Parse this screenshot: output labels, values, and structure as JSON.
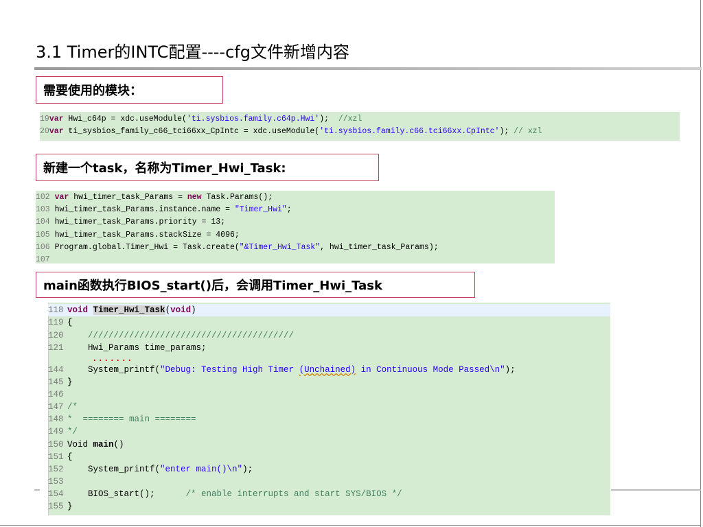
{
  "slide": {
    "title": "3.1 Timer的INTC配置----cfg文件新增内容"
  },
  "sections": {
    "s1_label": "需要使用的模块：",
    "s2_label": "新建一个task，名称为Timer_Hwi_Task:",
    "s3_label": "main函数执行BIOS_start()后，会调用Timer_Hwi_Task"
  },
  "code1": {
    "lines": [
      {
        "n": "19",
        "kw": "var",
        "pre": " Hwi_c64p = xdc.useModule(",
        "str": "'ti.sysbios.family.c64p.Hwi'",
        "post": ");  ",
        "cmt": "//xzl"
      },
      {
        "n": "20",
        "kw": "var",
        "pre": " ti_sysbios_family_c66_tci66xx_CpIntc = xdc.useModule(",
        "str": "'ti.sysbios.family.c66.tci66xx.CpIntc'",
        "post": "); ",
        "cmt": "// xzl"
      }
    ]
  },
  "code2": {
    "lines": [
      {
        "n": "102",
        "a": "var",
        "b": " hwi_timer_task_Params = ",
        "c": "new",
        "d": " Task.Params();"
      },
      {
        "n": "103",
        "a": "",
        "b": "hwi_timer_task_Params.instance.name = ",
        "s": "\"Timer_Hwi\"",
        "d": ";"
      },
      {
        "n": "104",
        "a": "",
        "b": "hwi_timer_task_Params.priority = 13;"
      },
      {
        "n": "105",
        "a": "",
        "b": "hwi_timer_task_Params.stackSize = 4096;"
      },
      {
        "n": "106",
        "a": "",
        "b": "Program.global.Timer_Hwi = Task.create(",
        "s": "\"&Timer_Hwi_Task\"",
        "d": ", hwi_timer_task_Params);"
      },
      {
        "n": "107",
        "a": "",
        "b": ""
      }
    ]
  },
  "code3": {
    "l118_n": "118",
    "l118_kw": "void",
    "l118_fn": "Timer_Hwi_Task",
    "l118_p1": "(",
    "l118_kw2": "void",
    "l118_p2": ")",
    "l119_n": "119",
    "l119_t": "{",
    "l120_n": "120",
    "l120_t": "    ////////////////////////////////////////",
    "l121_n": "121",
    "l121_t": "    Hwi_Params time_params;",
    "dots": ".......",
    "l144_n": "144",
    "l144_a": "    System_printf(",
    "l144_s1": "\"Debug: Testing High Timer ",
    "l144_u": "(Unchained)",
    "l144_s2": " in Continuous Mode Passed\\n\"",
    "l144_b": ");",
    "l145_n": "145",
    "l145_t": "}",
    "l146_n": "146",
    "l146_t": "",
    "l147_n": "147",
    "l147_t": "/*",
    "l148_n": "148",
    "l148_t": "*  ======== main ========",
    "l149_n": "149",
    "l149_t": "*/",
    "l150_n": "150",
    "l150_a": "Void ",
    "l150_fn": "main",
    "l150_b": "()",
    "l151_n": "151",
    "l151_t": "{",
    "l152_n": "152",
    "l152_a": "    System_printf(",
    "l152_s": "\"enter main()\\n\"",
    "l152_b": ");",
    "l153_n": "153",
    "l153_t": "",
    "l154_n": "154",
    "l154_a": "    BIOS_start();      ",
    "l154_c": "/* enable interrupts and start SYS/BIOS */",
    "l155_n": "155",
    "l155_t": "}"
  }
}
